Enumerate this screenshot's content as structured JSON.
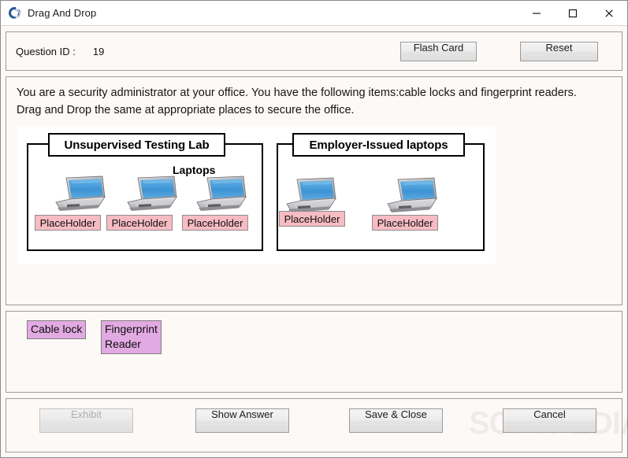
{
  "window": {
    "title": "Drag And Drop",
    "icon": "app-c-logo-icon",
    "controls": {
      "minimize": "minimize-icon",
      "maximize": "maximize-icon",
      "close": "close-icon"
    }
  },
  "header": {
    "question_id_label": "Question ID :",
    "question_id_value": "19",
    "flash_card_label": "Flash Card",
    "reset_label": "Reset"
  },
  "question": {
    "text": "You are a security administrator at your office. You have the following items:cable locks and fingerprint readers. Drag and Drop the same at appropriate places to secure the office.",
    "diagram": {
      "groups": [
        {
          "title": "Unsupervised Testing Lab",
          "sub_label": "Laptops",
          "drop_targets": [
            "PlaceHolder",
            "PlaceHolder",
            "PlaceHolder"
          ]
        },
        {
          "title": "Employer-Issued laptops",
          "sub_label": "",
          "drop_targets": [
            "PlaceHolder",
            "PlaceHolder"
          ]
        }
      ]
    }
  },
  "drag_items": [
    {
      "label": "Cable lock"
    },
    {
      "label": "Fingerprint\nReader"
    }
  ],
  "footer": {
    "exhibit_label": "Exhibit",
    "show_answer_label": "Show Answer",
    "save_close_label": "Save & Close",
    "cancel_label": "Cancel",
    "watermark": "SOFTPEDIA"
  },
  "colors": {
    "window_bg": "#fdf9f7",
    "drop_target": "#f7bcc3",
    "drag_item": "#e2aae2",
    "accent": "#2b5797"
  }
}
